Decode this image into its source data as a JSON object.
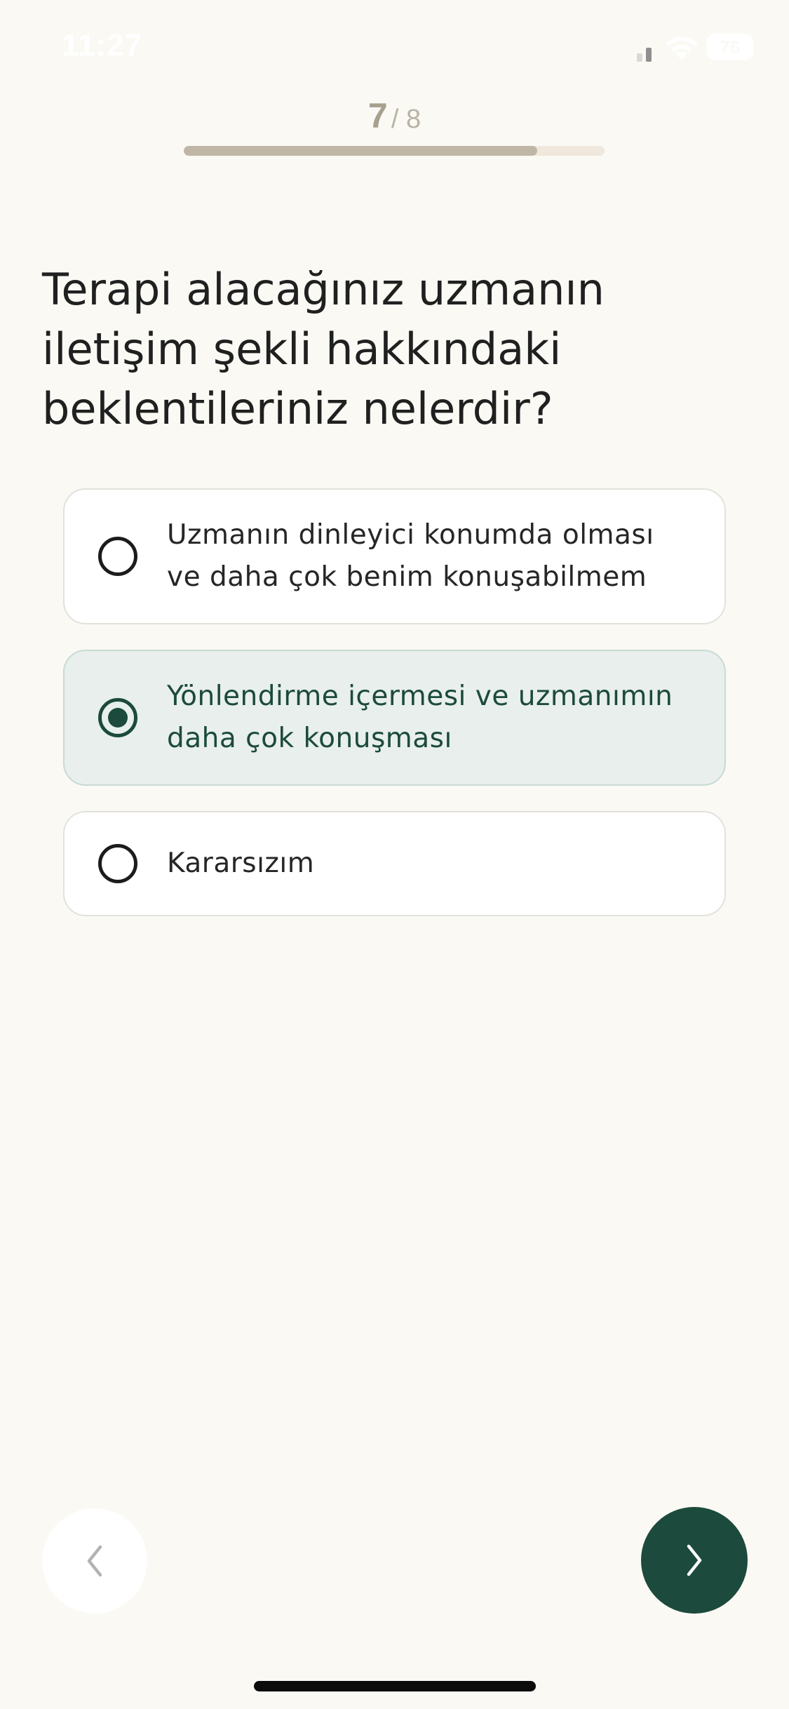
{
  "status_bar": {
    "time": "11:27",
    "battery": "76",
    "signal_icon": "signal-icon",
    "wifi_icon": "wifi-icon",
    "battery_icon": "battery-icon"
  },
  "progress": {
    "current": "7",
    "total": "/ 8",
    "fill_fraction": 0.84
  },
  "question": {
    "title": "Terapi alacağınız uzmanın iletişim şekli hakkındaki beklentileriniz nelerdir?"
  },
  "options": [
    {
      "label": "Uzmanın dinleyici konumda olması ve daha çok benim konuşabilmem",
      "selected": false
    },
    {
      "label": "Yönlendirme içermesi ve uzmanımın daha çok konuşması",
      "selected": true
    },
    {
      "label": "Kararsızım",
      "selected": false
    }
  ],
  "navigation": {
    "back_icon": "chevron-left-icon",
    "next_icon": "chevron-right-icon"
  },
  "colors": {
    "background": "#faf9f4",
    "accent": "#1c4a3c",
    "selected_option_bg": "#e8efec",
    "progress_fill": "#bfb6a6",
    "progress_track": "#f0e8dc"
  }
}
